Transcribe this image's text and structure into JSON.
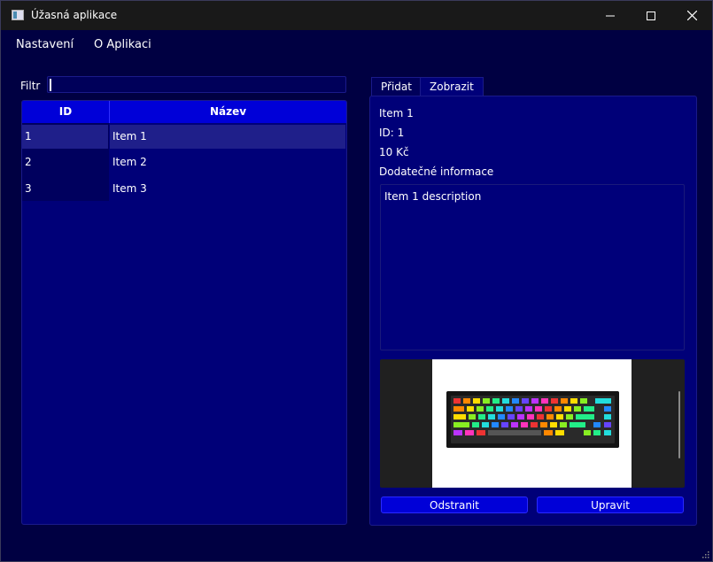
{
  "window": {
    "title": "Úžasná aplikace"
  },
  "menu": [
    "Nastavení",
    "O Aplikaci"
  ],
  "filter": {
    "label": "Filtr",
    "value": ""
  },
  "table": {
    "columns": [
      "ID",
      "Název"
    ],
    "rows": [
      {
        "id": "1",
        "name": "Item 1"
      },
      {
        "id": "2",
        "name": "Item 2"
      },
      {
        "id": "3",
        "name": "Item 3"
      }
    ]
  },
  "tabs": [
    "Přidat",
    "Zobrazit"
  ],
  "detail": {
    "name": "Item 1",
    "id_line": "ID: 1",
    "price": "10 Kč",
    "extra_label": "Dodatečné informace",
    "description": "Item 1 description"
  },
  "buttons": {
    "delete": "Odstranit",
    "edit": "Upravit"
  },
  "colors": {
    "background": "#000042",
    "panel": "#000078",
    "accent": "#0000d8",
    "selected_row": "#1f1f8a"
  }
}
